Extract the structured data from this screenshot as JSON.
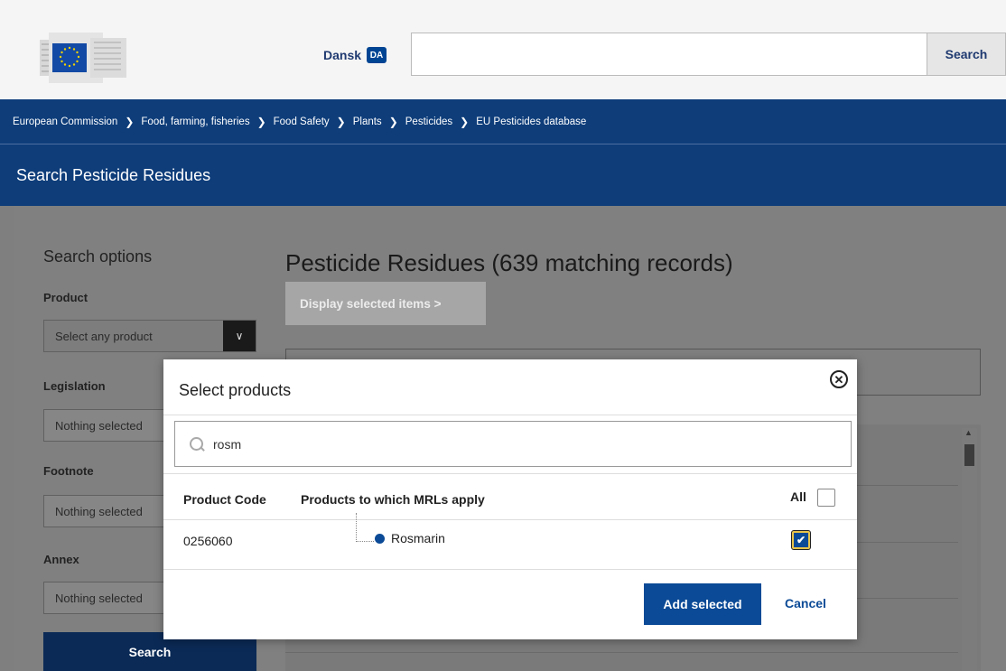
{
  "header": {
    "language_label": "Dansk",
    "language_code": "DA",
    "search_placeholder": "",
    "search_button": "Search"
  },
  "breadcrumb": [
    "European Commission",
    "Food, farming, fisheries",
    "Food Safety",
    "Plants",
    "Pesticides",
    "EU Pesticides database"
  ],
  "page_title": "Search Pesticide Residues",
  "sidebar": {
    "title": "Search options",
    "product_label": "Product",
    "product_select": "Select any product",
    "legislation_label": "Legislation",
    "legislation_select": "Nothing selected",
    "footnote_label": "Footnote",
    "footnote_select": "Nothing selected",
    "annex_label": "Annex",
    "annex_select": "Nothing selected",
    "search_button": "Search"
  },
  "main": {
    "title": "Pesticide Residues (639 matching records)",
    "display_button": "Display selected items  >"
  },
  "modal": {
    "title": "Select products",
    "search_value": "rosm",
    "col_code": "Product Code",
    "col_products": "Products to which MRLs apply",
    "all_label": "All",
    "rows": [
      {
        "code": "0256060",
        "name": "Rosmarin",
        "checked": true
      }
    ],
    "add_button": "Add selected",
    "cancel_link": "Cancel"
  },
  "colors": {
    "brand_blue": "#0e3d7a",
    "button_blue": "#0b4a96",
    "focus_yellow": "#e8c44a"
  }
}
